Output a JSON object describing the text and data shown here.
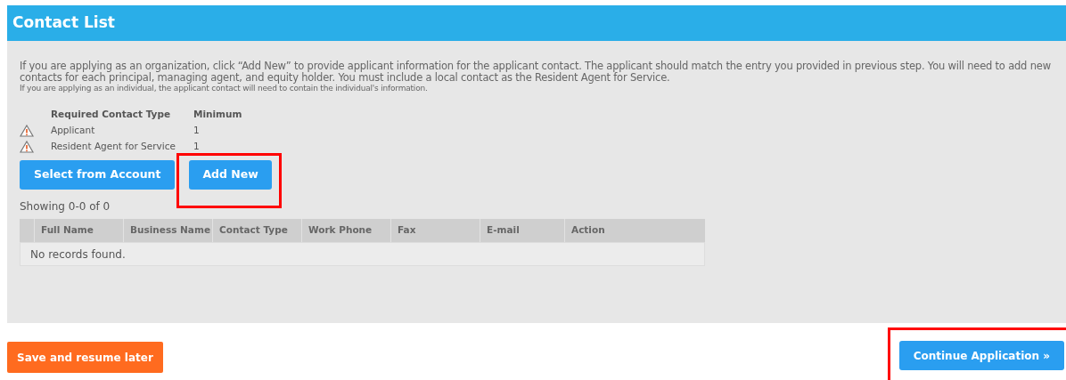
{
  "header": {
    "title": "Contact List"
  },
  "instructions": [
    "If you are applying as an organization, click “Add New” to provide applicant information for the applicant contact. The applicant should match the entry you provided in previous step. You will need to add new contacts for each principal, managing agent, and equity holder. You must include a local contact as the Resident Agent for Service.",
    "If you are applying as an individual, the applicant contact will need to contain the individual's information."
  ],
  "requirements": {
    "columns": [
      "Required Contact Type",
      "Minimum"
    ],
    "rows": [
      {
        "type": "Applicant",
        "minimum": "1",
        "warning": true
      },
      {
        "type": "Resident Agent for Service",
        "minimum": "1",
        "warning": true
      }
    ]
  },
  "buttons": [
    "Select from Account",
    "Add New"
  ],
  "table": {
    "summary": "Showing 0-0 of 0",
    "columns": [
      "Full Name",
      "Business Name",
      "Contact Type",
      "Work Phone",
      "Fax",
      "E-mail",
      "Action"
    ],
    "empty_message": "No records found."
  },
  "footer": {
    "save_button": "Save and resume later",
    "continue_button": "Continue Application »"
  }
}
